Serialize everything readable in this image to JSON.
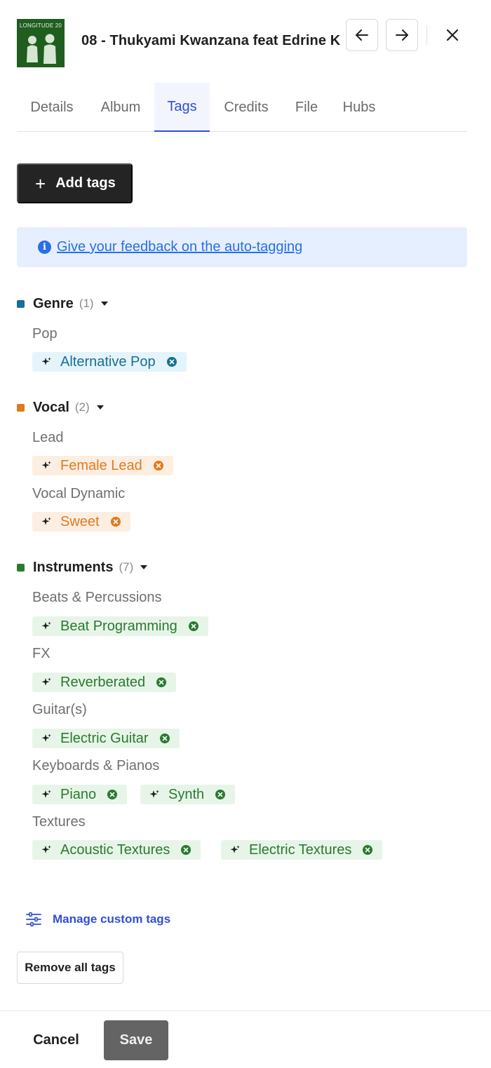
{
  "header": {
    "cover_text": "LONGITUDE 20",
    "track_title": "08 - Thukyami Kwanzana feat Edrine K",
    "prev_icon": "arrow-left-icon",
    "next_icon": "arrow-right-icon",
    "close_icon": "close-icon"
  },
  "tabs": [
    {
      "label": "Details"
    },
    {
      "label": "Album"
    },
    {
      "label": "Tags",
      "active": true
    },
    {
      "label": "Credits"
    },
    {
      "label": "File"
    },
    {
      "label": "Hubs"
    }
  ],
  "actions": {
    "add_tags_icon": "+",
    "add_tags_label": "Add tags"
  },
  "info": {
    "icon": "i",
    "feedback_link": "Give your feedback on the auto-tagging"
  },
  "categories": {
    "genre": {
      "name": "Genre",
      "count": "(1)",
      "color": "#1a6e96",
      "groups": [
        {
          "label": "Pop",
          "tags": [
            "Alternative Pop"
          ]
        }
      ]
    },
    "vocal": {
      "name": "Vocal",
      "count": "(2)",
      "color": "#e07a1f",
      "groups": [
        {
          "label": "Lead",
          "tags": [
            "Female Lead"
          ]
        },
        {
          "label": "Vocal Dynamic",
          "tags": [
            "Sweet"
          ]
        }
      ]
    },
    "instruments": {
      "name": "Instruments",
      "count": "(7)",
      "color": "#2a7a30",
      "groups": [
        {
          "label": "Beats & Percussions",
          "tags": [
            "Beat Programming"
          ]
        },
        {
          "label": "FX",
          "tags": [
            "Reverberated"
          ]
        },
        {
          "label": "Guitar(s)",
          "tags": [
            "Electric Guitar"
          ]
        },
        {
          "label": "Keyboards & Pianos",
          "tags": [
            "Piano",
            "Synth"
          ]
        },
        {
          "label": "Textures",
          "tags": [
            "Acoustic Textures",
            "Electric Textures"
          ]
        }
      ]
    }
  },
  "manage": {
    "icon": "sliders-icon",
    "label": "Manage custom tags"
  },
  "remove_all_label": "Remove all tags",
  "footer": {
    "cancel_label": "Cancel",
    "save_label": "Save"
  }
}
